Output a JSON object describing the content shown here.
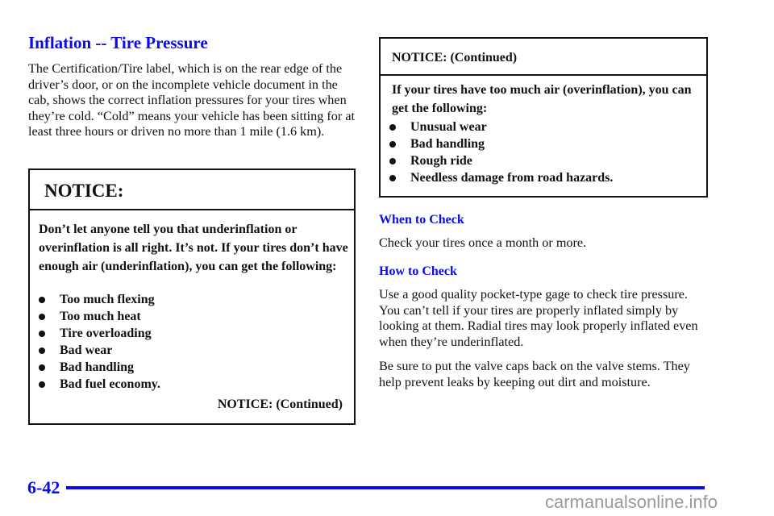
{
  "title": "Inflation -- Tire Pressure",
  "intro": "The Certification/Tire label, which is on the rear edge of the driver’s door, or on the incomplete vehicle document in the cab, shows the correct inflation pressures for your tires when they’re cold. “Cold” means your vehicle has been sitting for at least three hours or driven no more than 1 mile (1.6 km).",
  "notice1": {
    "heading": "NOTICE:",
    "text": "Don’t let anyone tell you that underinflation or overinflation is all right. It’s not. If your tires don’t have enough air (underinflation), you can get the following:",
    "items": [
      "Too much flexing",
      "Too much heat",
      "Tire overloading",
      "Bad wear",
      "Bad handling",
      "Bad fuel economy."
    ],
    "continued": "NOTICE: (Continued)"
  },
  "notice2": {
    "heading": "NOTICE: (Continued)",
    "text": "If your tires have too much air (overinflation), you can get the following:",
    "items": [
      "Unusual wear",
      "Bad handling",
      "Rough ride",
      "Needless damage from road hazards."
    ]
  },
  "when": {
    "heading": "When to Check",
    "text": "Check your tires once a month or more."
  },
  "how": {
    "heading": "How to Check",
    "text1": "Use a good quality pocket-type gage to check tire pressure. You can’t tell if your tires are properly inflated simply by looking at them. Radial tires may look properly inflated even when they’re underinflated.",
    "text2": "Be sure to put the valve caps back on the valve stems. They help prevent leaks by keeping out dirt and moisture."
  },
  "footer": {
    "page": "6-42",
    "watermark": "carmanualsonline.info"
  },
  "colors": {
    "accent": "#0a0af0"
  }
}
